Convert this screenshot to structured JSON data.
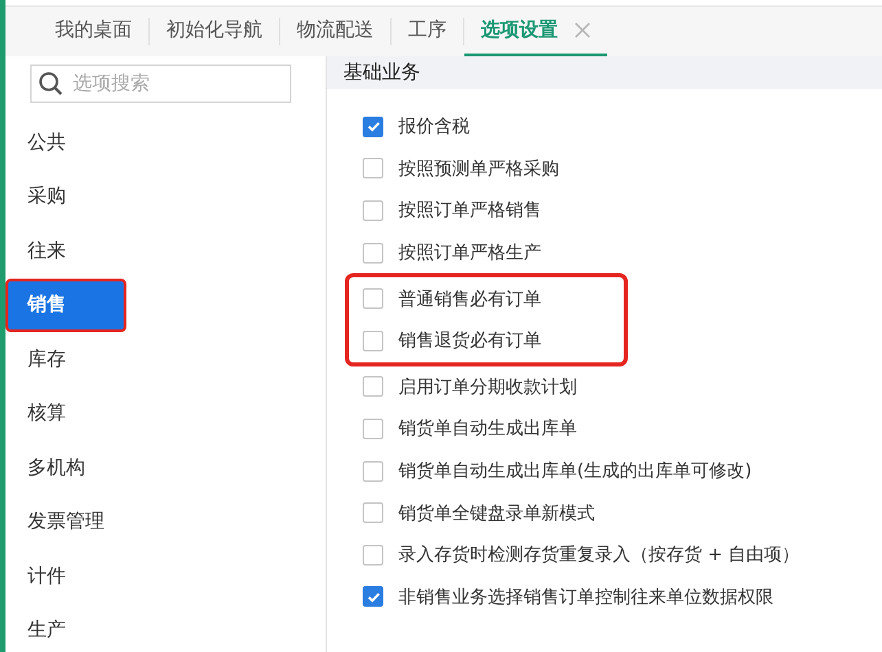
{
  "tabs": [
    {
      "label": "我的桌面",
      "selected": false,
      "closable": false
    },
    {
      "label": "初始化导航",
      "selected": false,
      "closable": false
    },
    {
      "label": "物流配送",
      "selected": false,
      "closable": false
    },
    {
      "label": "工序",
      "selected": false,
      "closable": false
    },
    {
      "label": "选项设置",
      "selected": true,
      "closable": true
    }
  ],
  "search": {
    "placeholder": "选项搜索"
  },
  "sidebar": {
    "items": [
      {
        "label": "公共",
        "selected": false,
        "highlighted": false
      },
      {
        "label": "采购",
        "selected": false,
        "highlighted": false
      },
      {
        "label": "往来",
        "selected": false,
        "highlighted": false
      },
      {
        "label": "销售",
        "selected": true,
        "highlighted": true
      },
      {
        "label": "库存",
        "selected": false,
        "highlighted": false
      },
      {
        "label": "核算",
        "selected": false,
        "highlighted": false
      },
      {
        "label": "多机构",
        "selected": false,
        "highlighted": false
      },
      {
        "label": "发票管理",
        "selected": false,
        "highlighted": false
      },
      {
        "label": "计件",
        "selected": false,
        "highlighted": false
      },
      {
        "label": "生产",
        "selected": false,
        "highlighted": false
      }
    ]
  },
  "section": {
    "title": "基础业务",
    "options": [
      {
        "kind": "option",
        "label": "报价含税",
        "checked": true
      },
      {
        "kind": "option",
        "label": "按照预测单严格采购",
        "checked": false
      },
      {
        "kind": "option",
        "label": "按照订单严格销售",
        "checked": false
      },
      {
        "kind": "option",
        "label": "按照订单严格生产",
        "checked": false
      },
      {
        "kind": "highlight",
        "children": [
          {
            "label": "普通销售必有订单",
            "checked": false
          },
          {
            "label": "销售退货必有订单",
            "checked": false
          }
        ]
      },
      {
        "kind": "option",
        "label": "启用订单分期收款计划",
        "checked": false
      },
      {
        "kind": "option",
        "label": "销货单自动生成出库单",
        "checked": false
      },
      {
        "kind": "option",
        "label": "销货单自动生成出库单(生成的出库单可修改)",
        "checked": false
      },
      {
        "kind": "option",
        "label": "销货单全键盘录单新模式",
        "checked": false
      },
      {
        "kind": "option",
        "label": "录入存货时检测存货重复录入（按存货 + 自由项）",
        "checked": false
      },
      {
        "kind": "option",
        "label": "非销售业务选择销售订单控制往来单位数据权限",
        "checked": true
      }
    ]
  }
}
